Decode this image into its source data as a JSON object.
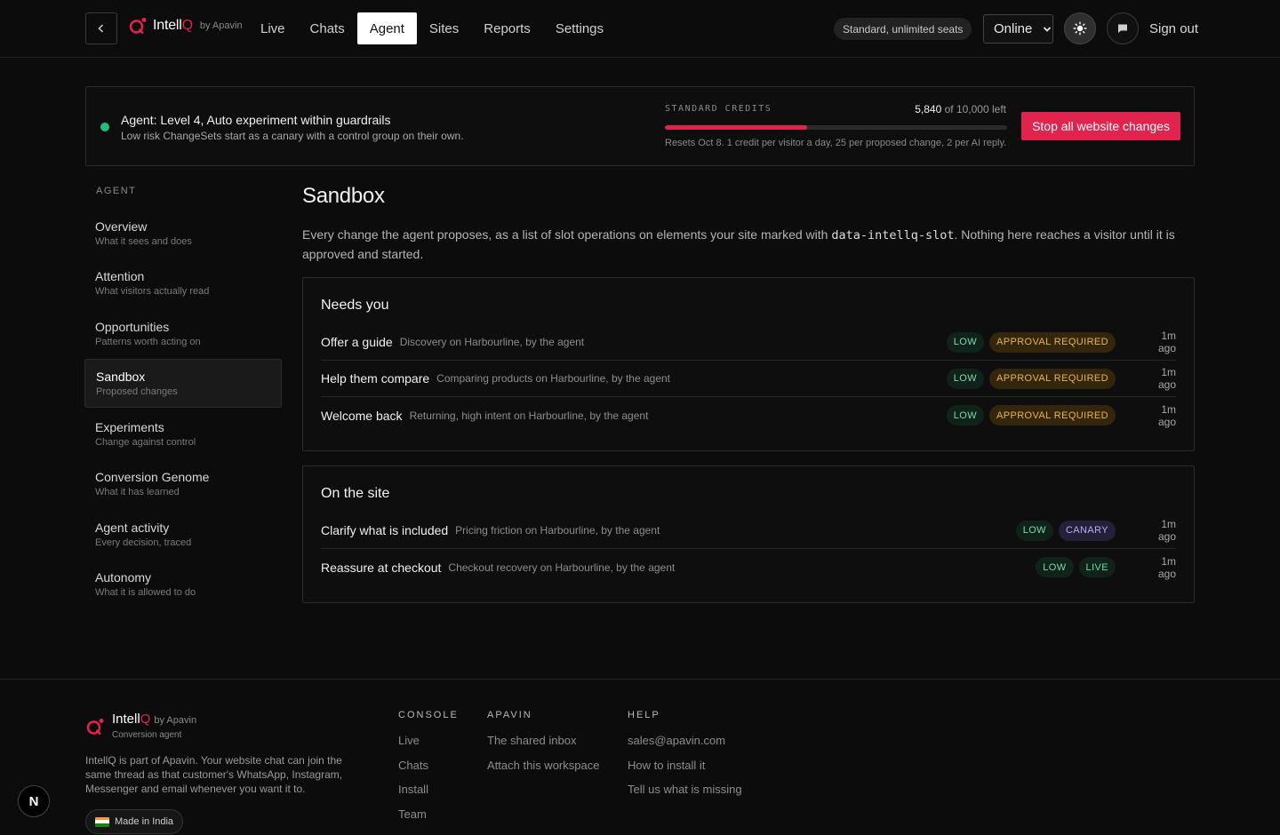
{
  "header": {
    "brand_name_main": "Intell",
    "brand_name_accent": "Q",
    "brand_by": "by Apavin",
    "nav": [
      {
        "label": "Live"
      },
      {
        "label": "Chats"
      },
      {
        "label": "Agent"
      },
      {
        "label": "Sites"
      },
      {
        "label": "Reports"
      },
      {
        "label": "Settings"
      }
    ],
    "active_nav": "Agent",
    "plan": "Standard, unlimited seats",
    "status": "Online",
    "sign_out": "Sign out",
    "icons": [
      "chevron-left-icon",
      "sun-icon",
      "chat-bubble-icon",
      "chevron-down-icon"
    ]
  },
  "banner": {
    "title": "Agent: Level 4, Auto experiment within guardrails",
    "subtitle": "Low risk ChangeSets start as a canary with a control group on their own.",
    "credits_label": "STANDARD CREDITS",
    "credits_left": "5,840",
    "credits_total_text": "of 10,000 left",
    "credits_fraction_used": 0.416,
    "credits_note": "Resets Oct 8. 1 credit per visitor a day, 25 per proposed change, 2 per AI reply.",
    "stop_button": "Stop all website changes",
    "status_color": "#21c07a",
    "accent_color": "#e0244d"
  },
  "sidebar": {
    "heading": "AGENT",
    "items": [
      {
        "label": "Overview",
        "desc": "What it sees and does"
      },
      {
        "label": "Attention",
        "desc": "What visitors actually read"
      },
      {
        "label": "Opportunities",
        "desc": "Patterns worth acting on"
      },
      {
        "label": "Sandbox",
        "desc": "Proposed changes"
      },
      {
        "label": "Experiments",
        "desc": "Change against control"
      },
      {
        "label": "Conversion Genome",
        "desc": "What it has learned"
      },
      {
        "label": "Agent activity",
        "desc": "Every decision, traced"
      },
      {
        "label": "Autonomy",
        "desc": "What it is allowed to do"
      }
    ],
    "active": "Sandbox"
  },
  "main": {
    "title": "Sandbox",
    "desc_before": "Every change the agent proposes, as a list of slot operations on elements your site marked with ",
    "desc_code": "data-intellq-slot",
    "desc_after": ". Nothing here reaches a visitor until it is approved and started.",
    "needs_you": {
      "title": "Needs you",
      "rows": [
        {
          "name": "Offer a guide",
          "meta": "Discovery on Harbourline, by the agent",
          "risk": "LOW",
          "state": "APPROVAL REQUIRED",
          "time": "1m ago"
        },
        {
          "name": "Help them compare",
          "meta": "Comparing products on Harbourline, by the agent",
          "risk": "LOW",
          "state": "APPROVAL REQUIRED",
          "time": "1m ago"
        },
        {
          "name": "Welcome back",
          "meta": "Returning, high intent on Harbourline, by the agent",
          "risk": "LOW",
          "state": "APPROVAL REQUIRED",
          "time": "1m ago"
        }
      ]
    },
    "on_site": {
      "title": "On the site",
      "rows": [
        {
          "name": "Clarify what is included",
          "meta": "Pricing friction on Harbourline, by the agent",
          "risk": "LOW",
          "state": "CANARY",
          "time": "1m ago"
        },
        {
          "name": "Reassure at checkout",
          "meta": "Checkout recovery on Harbourline, by the agent",
          "risk": "LOW",
          "state": "LIVE",
          "time": "1m ago"
        }
      ]
    }
  },
  "footer": {
    "brand_main": "Intell",
    "brand_accent": "Q",
    "brand_by": "by Apavin",
    "tagline": "Conversion agent",
    "about": "IntellQ is part of Apavin. Your website chat can join the same thread as that customer's WhatsApp, Instagram, Messenger and email whenever you want it to.",
    "made_in": "Made in India",
    "columns": [
      {
        "heading": "CONSOLE",
        "links": [
          "Live",
          "Chats",
          "Install",
          "Team"
        ]
      },
      {
        "heading": "APAVIN",
        "links": [
          "The shared inbox",
          "Attach this workspace"
        ]
      },
      {
        "heading": "HELP",
        "links": [
          "sales@apavin.com",
          "How to install it",
          "Tell us what is missing"
        ]
      }
    ]
  },
  "corner_badge": "N"
}
